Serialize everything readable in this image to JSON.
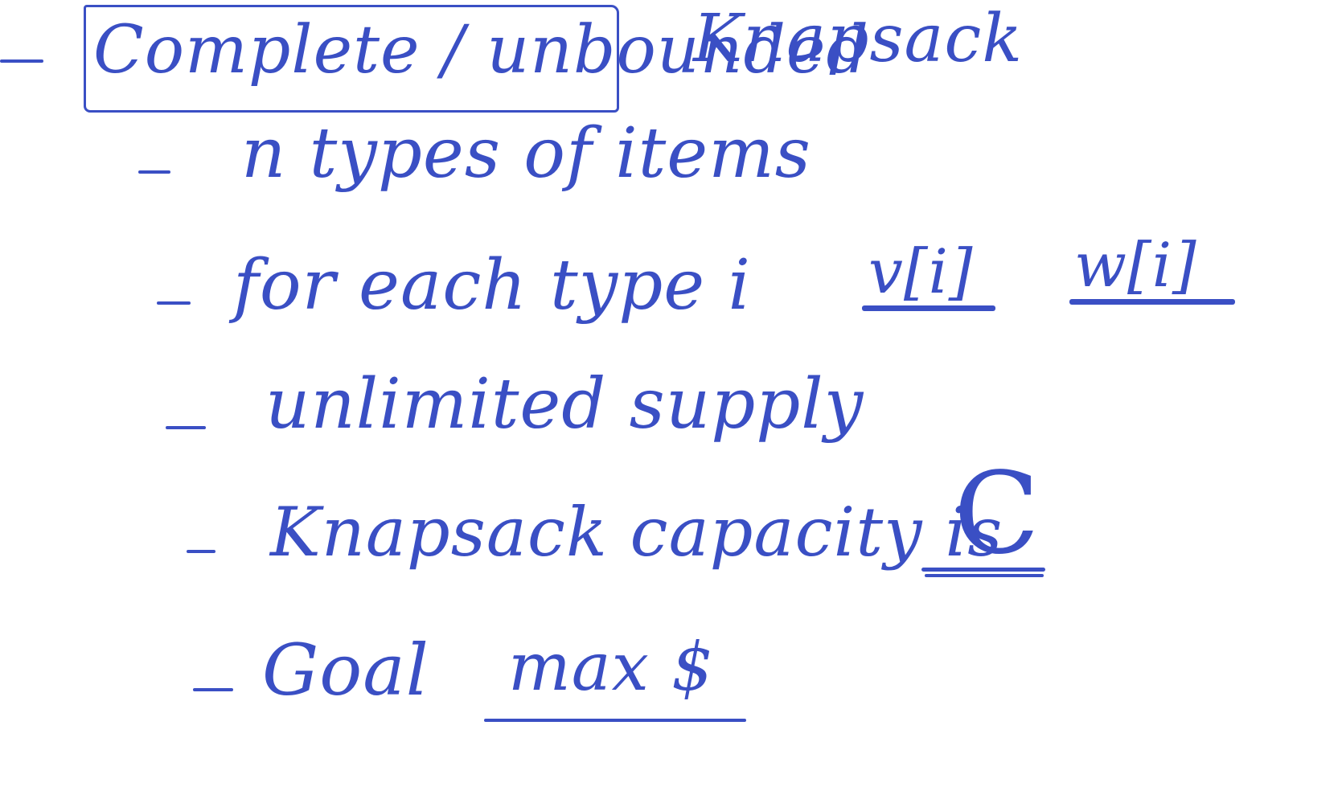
{
  "ink_color": "#3a4fc4",
  "notes": {
    "heading": {
      "boxed_text": "Complete / unbounded",
      "rest_text": "Knapsack"
    },
    "items": [
      {
        "text": "n types of items"
      },
      {
        "text": "for each type i",
        "tags": [
          "v[i]",
          "w[i]"
        ]
      },
      {
        "text": "unlimited supply"
      },
      {
        "text": "Knapsack capacity is",
        "value": "C"
      },
      {
        "text": "Goal",
        "value": "max $"
      }
    ]
  }
}
